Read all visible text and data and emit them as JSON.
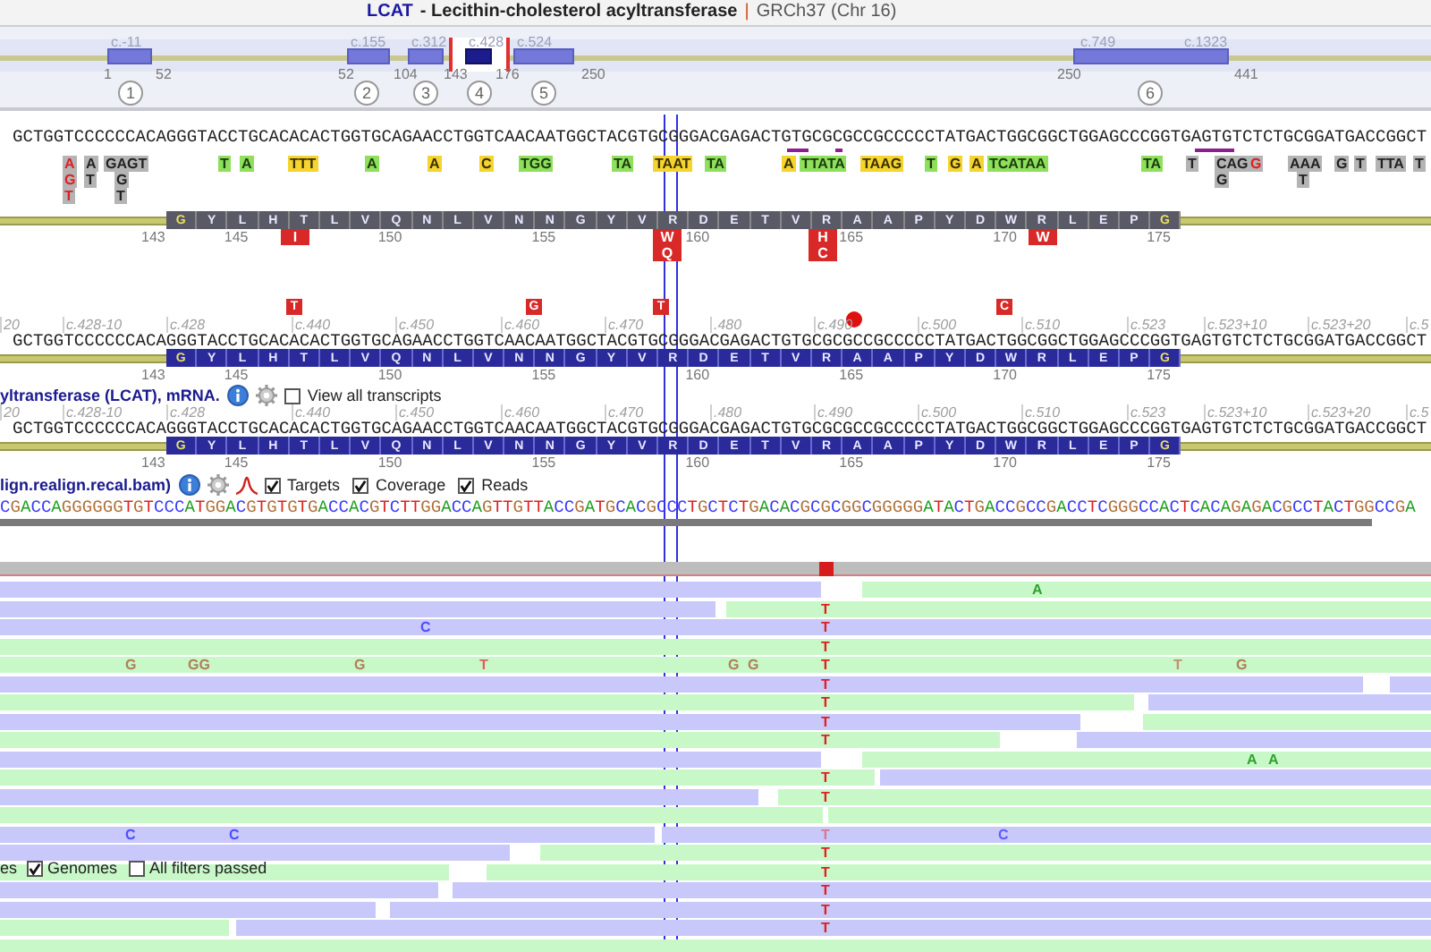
{
  "header": {
    "gene": "LCAT",
    "description": "- Lecithin-cholesterol acyltransferase",
    "separator": "|",
    "assembly": "GRCh37 (Chr 16)"
  },
  "exon_map": {
    "exons": [
      {
        "number": "1",
        "cdna": [
          "c.-11"
        ],
        "selected": false
      },
      {
        "number": "2",
        "cdna": [
          "c.155"
        ],
        "selected": false
      },
      {
        "number": "3",
        "cdna": [
          "c.312"
        ],
        "selected": false
      },
      {
        "number": "4",
        "cdna": [
          "c.428"
        ],
        "selected": true
      },
      {
        "number": "5",
        "cdna": [
          "c.524"
        ],
        "selected": false
      },
      {
        "number": "6",
        "cdna": [
          "c.749",
          "c.1323"
        ],
        "selected": false
      }
    ],
    "positions": [
      "1",
      "52",
      "52",
      "104",
      "143",
      "176",
      "250",
      "250",
      "441"
    ]
  },
  "genome_track": {
    "sequence": "GCTGGTCCCCCCACAGGGTACCTGCACACACTGGTGCAGAACCTGGTCAACAATGGCTACGTGCGGGACGAGACTGTGCGCGCCGCCCCCTATGACTGGCGGCTGGAGCCCGGTGAGTGTCTCTGCGGATGACCGGCT",
    "variants": [
      {
        "text": "A",
        "kind": "flagged",
        "below": [
          "G",
          "T"
        ]
      },
      {
        "text": "A",
        "kind": "other",
        "below": [
          "T"
        ]
      },
      {
        "text": "GAGT",
        "kind": "other",
        "below": [
          "G",
          "T"
        ]
      },
      {
        "text": "T",
        "kind": "common"
      },
      {
        "text": "A",
        "kind": "common"
      },
      {
        "text": "TTT",
        "kind": "rare"
      },
      {
        "text": "A",
        "kind": "common"
      },
      {
        "text": "A",
        "kind": "rare"
      },
      {
        "text": "C",
        "kind": "rare"
      },
      {
        "text": "TGG",
        "kind": "common"
      },
      {
        "text": "TA",
        "kind": "common"
      },
      {
        "text": "TAAT",
        "kind": "rare"
      },
      {
        "text": "TA",
        "kind": "common"
      },
      {
        "text": "A",
        "kind": "rare"
      },
      {
        "text": "TTATA",
        "kind": "common"
      },
      {
        "text": "TAAG",
        "kind": "rare"
      },
      {
        "text": "T",
        "kind": "common"
      },
      {
        "text": "G",
        "kind": "rare"
      },
      {
        "text": "A",
        "kind": "rare"
      },
      {
        "text": "TCATAA",
        "kind": "common"
      },
      {
        "text": "TA",
        "kind": "common"
      },
      {
        "text": "T",
        "kind": "other"
      },
      {
        "text": "CAG",
        "kind": "other",
        "below": [
          "G"
        ]
      },
      {
        "text": "G",
        "kind": "flagged"
      },
      {
        "text": "AAA",
        "kind": "other",
        "below": [
          "T"
        ]
      },
      {
        "text": "G",
        "kind": "other"
      },
      {
        "text": "T",
        "kind": "other"
      },
      {
        "text": "TTA",
        "kind": "other"
      },
      {
        "text": "T",
        "kind": "other"
      }
    ],
    "protein": {
      "residues": [
        "G",
        "Y",
        "L",
        "H",
        "T",
        "L",
        "V",
        "Q",
        "N",
        "L",
        "V",
        "N",
        "N",
        "G",
        "Y",
        "V",
        "R",
        "D",
        "E",
        "T",
        "V",
        "R",
        "A",
        "A",
        "P",
        "Y",
        "D",
        "W",
        "R",
        "L",
        "E",
        "P",
        "G"
      ],
      "split_ends": true
    },
    "residue_numbers": [
      "143",
      "145",
      "150",
      "155",
      "160",
      "165",
      "170",
      "175"
    ],
    "substitutions": [
      {
        "lines": [
          "I"
        ]
      },
      {
        "lines": [
          "W",
          "Q"
        ]
      },
      {
        "lines": [
          "H",
          "C"
        ]
      },
      {
        "lines": [
          "W"
        ]
      }
    ]
  },
  "coding_track": {
    "markers": [
      {
        "kind": "letter",
        "text": "T"
      },
      {
        "kind": "letter",
        "text": "G"
      },
      {
        "kind": "letter",
        "text": "T"
      },
      {
        "kind": "dot"
      },
      {
        "kind": "letter",
        "text": "C"
      }
    ],
    "ticks": [
      "20",
      "c.428-10",
      "c.428",
      "c.440",
      "c.450",
      "c.460",
      "c.470",
      ".480",
      "c.490",
      "c.500",
      "c.510",
      "c.523",
      "c.523+10",
      "c.523+20",
      "c.5"
    ],
    "sequence": "GCTGGTCCCCCCACAGGGTACCTGCACACACTGGTGCAGAACCTGGTCAACAATGGCTACGTGCGGGACGAGACTGTGCGCGCCGCCCCCTATGACTGGCGGCTGGAGCCCGGTGAGTGTCTCTGCGGATGACCGGCT",
    "protein": {
      "residues": [
        "G",
        "Y",
        "L",
        "H",
        "T",
        "L",
        "V",
        "Q",
        "N",
        "L",
        "V",
        "N",
        "N",
        "G",
        "Y",
        "V",
        "R",
        "D",
        "E",
        "T",
        "V",
        "R",
        "A",
        "A",
        "P",
        "Y",
        "D",
        "W",
        "R",
        "L",
        "E",
        "P",
        "G"
      ],
      "split_ends": true
    },
    "residue_numbers": [
      "143",
      "145",
      "150",
      "155",
      "160",
      "165",
      "170",
      "175"
    ]
  },
  "transcript_track": {
    "title": "yltransferase (LCAT), mRNA.",
    "view_all": {
      "label": "View all transcripts",
      "checked": false
    },
    "ticks": [
      "20",
      "c.428-10",
      "c.428",
      "c.440",
      "c.450",
      "c.460",
      "c.470",
      ".480",
      "c.490",
      "c.500",
      "c.510",
      "c.523",
      "c.523+10",
      "c.523+20",
      "c.5"
    ],
    "sequence": "GCTGGTCCCCCCACAGGGTACCTGCACACACTGGTGCAGAACCTGGTCAACAATGGCTACGTGCGGGACGAGACTGTGCGCGCCGCCCCCTATGACTGGCGGCTGGAGCCCGGTGAGTGTCTCTGCGGATGACCGGCT",
    "protein": {
      "residues": [
        "G",
        "Y",
        "L",
        "H",
        "T",
        "L",
        "V",
        "Q",
        "N",
        "L",
        "V",
        "N",
        "N",
        "G",
        "Y",
        "V",
        "R",
        "D",
        "E",
        "T",
        "V",
        "R",
        "A",
        "A",
        "P",
        "Y",
        "D",
        "W",
        "R",
        "L",
        "E",
        "P",
        "G"
      ],
      "split_ends": true
    },
    "residue_numbers": [
      "143",
      "145",
      "150",
      "155",
      "160",
      "165",
      "170",
      "175"
    ]
  },
  "bam_track": {
    "title": "lign.realign.recal.bam)",
    "options": [
      {
        "label": "Targets",
        "checked": true
      },
      {
        "label": "Coverage",
        "checked": true
      },
      {
        "label": "Reads",
        "checked": true
      }
    ],
    "reference": "CGACCAGGGGGGTGTCCCATGGACGTGTGTGACCACGTCTTGGACCAGTTGTTACCGATGCACGCCCTGCTCTGACACGCGCGGCGGGGGATACTGACCGCCGACCTCGGGCCACTCACAGAGACGCCTACTGGCCGA",
    "reads": [
      {
        "segments": [
          {
            "kind": "reverse"
          },
          {
            "kind": "forward"
          }
        ],
        "mismatches": [
          {
            "text": "A",
            "color": "#30a030"
          }
        ]
      },
      {
        "segments": [
          {
            "kind": "reverse"
          },
          {
            "kind": "forward"
          }
        ],
        "mismatches": [
          {
            "text": "T",
            "color": "#e02020"
          }
        ]
      },
      {
        "segments": [
          {
            "kind": "reverse"
          }
        ],
        "mismatches": [
          {
            "text": "C",
            "color": "#5050ff"
          },
          {
            "text": "T",
            "color": "#e02020"
          }
        ]
      },
      {
        "segments": [
          {
            "kind": "forward"
          }
        ],
        "mismatches": [
          {
            "text": "T",
            "color": "#e02020"
          }
        ]
      },
      {
        "segments": [
          {
            "kind": "forward"
          }
        ],
        "mismatches": [
          {
            "text": "G",
            "color": "#b0805a"
          },
          {
            "text": "GG",
            "color": "#b0805a"
          },
          {
            "text": "G",
            "color": "#b0805a"
          },
          {
            "text": "T",
            "color": "#e06060"
          },
          {
            "text": "G",
            "color": "#b0805a"
          },
          {
            "text": "G",
            "color": "#b0805a"
          },
          {
            "text": "T",
            "color": "#e02020"
          },
          {
            "text": "T",
            "color": "#c09070"
          },
          {
            "text": "G",
            "color": "#b0805a"
          }
        ]
      },
      {
        "segments": [
          {
            "kind": "reverse"
          },
          {
            "kind": "reverse"
          }
        ],
        "mismatches": [
          {
            "text": "T",
            "color": "#e02020"
          }
        ]
      },
      {
        "segments": [
          {
            "kind": "forward"
          },
          {
            "kind": "reverse"
          }
        ],
        "mismatches": [
          {
            "text": "T",
            "color": "#e02020"
          }
        ]
      },
      {
        "segments": [
          {
            "kind": "reverse"
          },
          {
            "kind": "forward"
          }
        ],
        "mismatches": [
          {
            "text": "T",
            "color": "#e02020"
          }
        ]
      },
      {
        "segments": [
          {
            "kind": "forward"
          },
          {
            "kind": "reverse"
          }
        ],
        "mismatches": [
          {
            "text": "T",
            "color": "#e02020"
          }
        ]
      },
      {
        "segments": [
          {
            "kind": "reverse"
          },
          {
            "kind": "forward"
          }
        ],
        "mismatches": [
          {
            "text": "A",
            "color": "#30a030"
          },
          {
            "text": "A",
            "color": "#30a030"
          }
        ]
      },
      {
        "segments": [
          {
            "kind": "forward"
          },
          {
            "kind": "reverse"
          }
        ],
        "mismatches": [
          {
            "text": "T",
            "color": "#e02020"
          }
        ]
      },
      {
        "segments": [
          {
            "kind": "reverse"
          },
          {
            "kind": "forward"
          }
        ],
        "mismatches": [
          {
            "text": "T",
            "color": "#e02020"
          }
        ]
      },
      {
        "segments": [
          {
            "kind": "forward"
          },
          {
            "kind": "forward"
          }
        ]
      },
      {
        "segments": [
          {
            "kind": "reverse"
          },
          {
            "kind": "reverse"
          }
        ],
        "mismatches": [
          {
            "text": "C",
            "color": "#5050ff"
          },
          {
            "text": "C",
            "color": "#5050ff"
          },
          {
            "text": "T",
            "color": "#d87890"
          },
          {
            "text": "C",
            "color": "#6060ff"
          }
        ]
      },
      {
        "segments": [
          {
            "kind": "reverse"
          },
          {
            "kind": "forward"
          }
        ],
        "mismatches": [
          {
            "text": "T",
            "color": "#e02020"
          }
        ]
      },
      {
        "segments": [
          {
            "kind": "forward"
          },
          {
            "kind": "forward"
          }
        ],
        "mismatches": [
          {
            "text": "T",
            "color": "#e02020"
          }
        ]
      },
      {
        "segments": [
          {
            "kind": "reverse"
          },
          {
            "kind": "reverse"
          }
        ],
        "mismatches": [
          {
            "text": "T",
            "color": "#e02020"
          }
        ]
      },
      {
        "segments": [
          {
            "kind": "reverse"
          },
          {
            "kind": "reverse"
          }
        ],
        "mismatches": [
          {
            "text": "T",
            "color": "#e02020"
          }
        ]
      },
      {
        "segments": [
          {
            "kind": "forward"
          },
          {
            "kind": "reverse"
          }
        ],
        "mismatches": [
          {
            "text": "T",
            "color": "#e02020"
          }
        ]
      },
      {
        "segments": [
          {
            "kind": "forward"
          }
        ]
      }
    ]
  },
  "filter_bar": {
    "cut_label": "es",
    "options": [
      {
        "label": "Genomes",
        "checked": true
      },
      {
        "label": "All filters passed",
        "checked": false
      }
    ]
  }
}
